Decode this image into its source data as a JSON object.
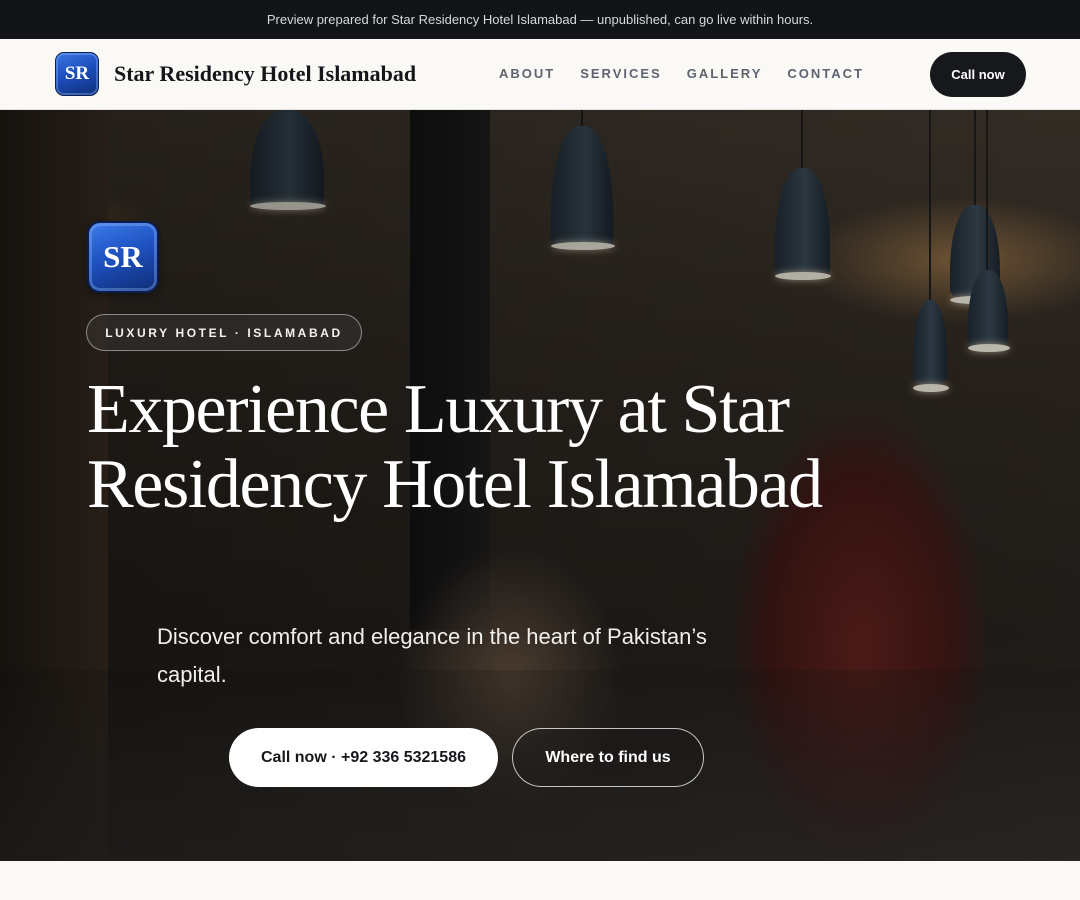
{
  "preview_notice": "Preview prepared for Star Residency Hotel Islamabad — unpublished, can go live within hours.",
  "header": {
    "logo_text": "SR",
    "brand_name": "Star Residency Hotel Islamabad",
    "nav": [
      {
        "label": "ABOUT"
      },
      {
        "label": "SERVICES"
      },
      {
        "label": "GALLERY"
      },
      {
        "label": "CONTACT"
      }
    ],
    "cta_label": "Call now"
  },
  "hero": {
    "logo_text": "SR",
    "badge": "LUXURY HOTEL · ISLAMABAD",
    "title": "Experience Luxury at Star Residency Hotel Islamabad",
    "subtitle": "Discover comfort and elegance in the heart of Pakistan’s capital.",
    "primary_button": "Call now · +92 336 5321586",
    "secondary_button": "Where to find us"
  },
  "colors": {
    "dark": "#16181c",
    "page_bg": "#faf9f6",
    "logo_blue": "#1d4fbd",
    "nav_text": "#5d6470"
  }
}
